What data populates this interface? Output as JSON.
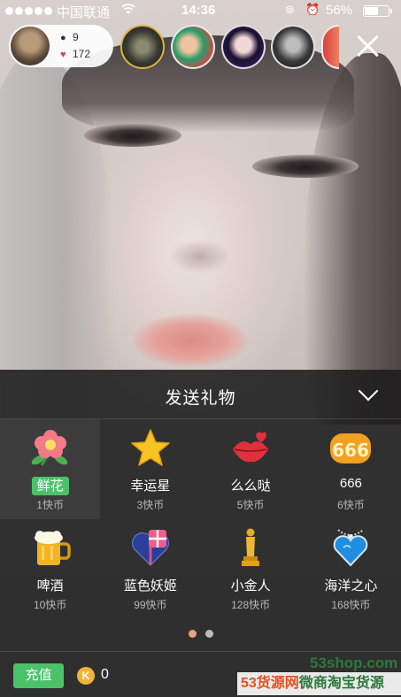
{
  "status_bar": {
    "carrier": "中国联通",
    "time": "14:36",
    "battery": "56%"
  },
  "host": {
    "viewers": "9",
    "likes": "172"
  },
  "gift_panel": {
    "title": "发送礼物",
    "page_count": 2,
    "active_page": 1,
    "gifts": [
      {
        "name": "鲜花",
        "price": "1快币",
        "icon": "flower-icon",
        "selected": true
      },
      {
        "name": "幸运星",
        "price": "3快币",
        "icon": "star-icon",
        "selected": false
      },
      {
        "name": "么么哒",
        "price": "5快币",
        "icon": "kiss-lips-icon",
        "selected": false
      },
      {
        "name": "666",
        "price": "6快币",
        "icon": "number-666-icon",
        "selected": false
      },
      {
        "name": "啤酒",
        "price": "10快币",
        "icon": "beer-icon",
        "selected": false
      },
      {
        "name": "蓝色妖姬",
        "price": "99快币",
        "icon": "heart-gift-box-icon",
        "selected": false
      },
      {
        "name": "小金人",
        "price": "128快币",
        "icon": "golden-statue-icon",
        "selected": false
      },
      {
        "name": "海洋之心",
        "price": "168快币",
        "icon": "heart-pendant-icon",
        "selected": false
      }
    ],
    "recharge_label": "充值",
    "coin_symbol": "K",
    "balance": "0"
  },
  "watermark": {
    "site": "53shop.com",
    "slogan_part1": "53货源网",
    "slogan_part2": "微商淘宝货源"
  }
}
